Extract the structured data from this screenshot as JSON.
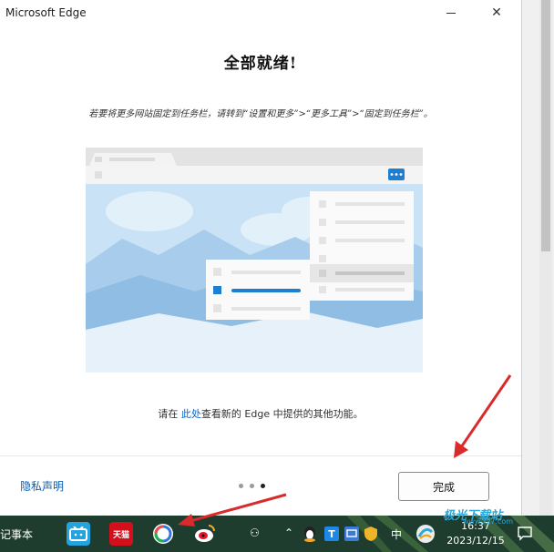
{
  "window": {
    "title": "Microsoft Edge",
    "minimize_glyph": "—",
    "close_glyph": "✕"
  },
  "page": {
    "heading": "全部就绪!",
    "description": "若要将更多网站固定到任务栏，请转到“设置和更多”>“更多工具”>“固定到任务栏”。",
    "info_prefix": "请在 ",
    "info_link": "此处",
    "info_suffix": "查看新的 Edge 中提供的其他功能。"
  },
  "footer": {
    "privacy_label": "隐私声明",
    "pager": {
      "total": 3,
      "current": 3
    },
    "done_label": "完成"
  },
  "taskbar": {
    "notepad_label": "记事本",
    "tmall_label": "天猫",
    "ime_label": "中",
    "time": "16:37",
    "date": "2023/12/15"
  },
  "watermark": {
    "text": "极光下载站",
    "url": "www.xz7.com"
  },
  "colors": {
    "accent": "#0b64c0",
    "illustration_sky": "#c7e0f4",
    "annotation": "#d92b2b"
  }
}
